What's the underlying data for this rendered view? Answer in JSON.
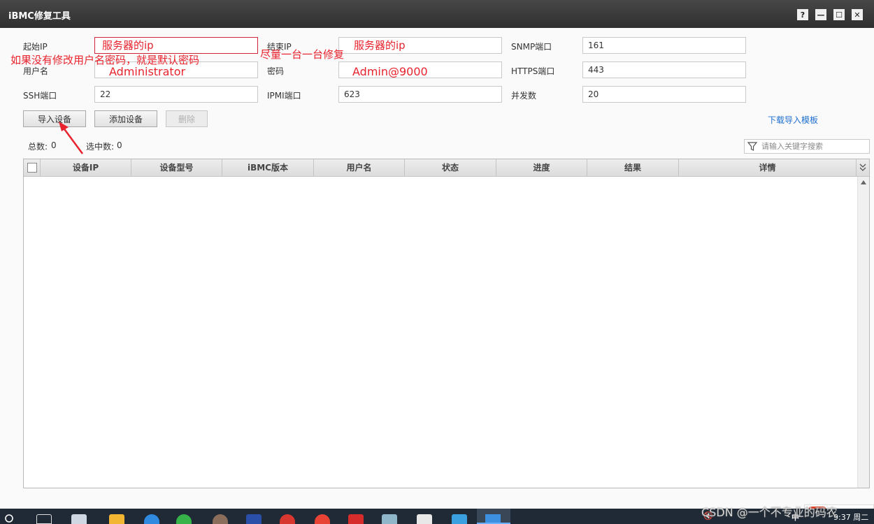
{
  "window": {
    "title": "iBMC修复工具",
    "help": "?",
    "minimize": "—",
    "maximize": "☐",
    "close": "✕"
  },
  "form": {
    "start_ip_label": "起始IP",
    "end_ip_label": "结束IP",
    "snmp_port_label": "SNMP端口",
    "snmp_port_value": "161",
    "username_label": "用户名",
    "password_label": "密码",
    "https_port_label": "HTTPS端口",
    "https_port_value": "443",
    "ssh_port_label": "SSH端口",
    "ssh_port_value": "22",
    "ipmi_port_label": "IPMI端口",
    "ipmi_port_value": "623",
    "concurrency_label": "并发数",
    "concurrency_value": "20"
  },
  "annotations": {
    "start_ip_note": "服务器的ip",
    "end_ip_note": "服务器的ip",
    "username_note": "Administrator",
    "password_note": "Admin@9000",
    "default_password_note": "如果没有修改用户名密码，就是默认密码",
    "one_by_one_note": "尽量一台一台修复"
  },
  "toolbar": {
    "import_label": "导入设备",
    "add_label": "添加设备",
    "delete_label": "删除",
    "download_template_label": "下载导入模板"
  },
  "counts": {
    "total_label": "总数:",
    "total_value": "0",
    "selected_label": "选中数:",
    "selected_value": "0"
  },
  "search": {
    "placeholder": "请输入关键字搜索"
  },
  "table": {
    "columns": [
      "设备IP",
      "设备型号",
      "iBMC版本",
      "用户名",
      "状态",
      "进度",
      "结果",
      "详情"
    ]
  },
  "taskbar": {
    "ime_label": "中",
    "tray_ime": "中",
    "clock": "9:37 周二"
  },
  "watermark": "CSDN @一个不专业的码农",
  "colors": {
    "titlebar": "#363636",
    "annotation": "#e8232d",
    "link": "#1e6fcf"
  }
}
